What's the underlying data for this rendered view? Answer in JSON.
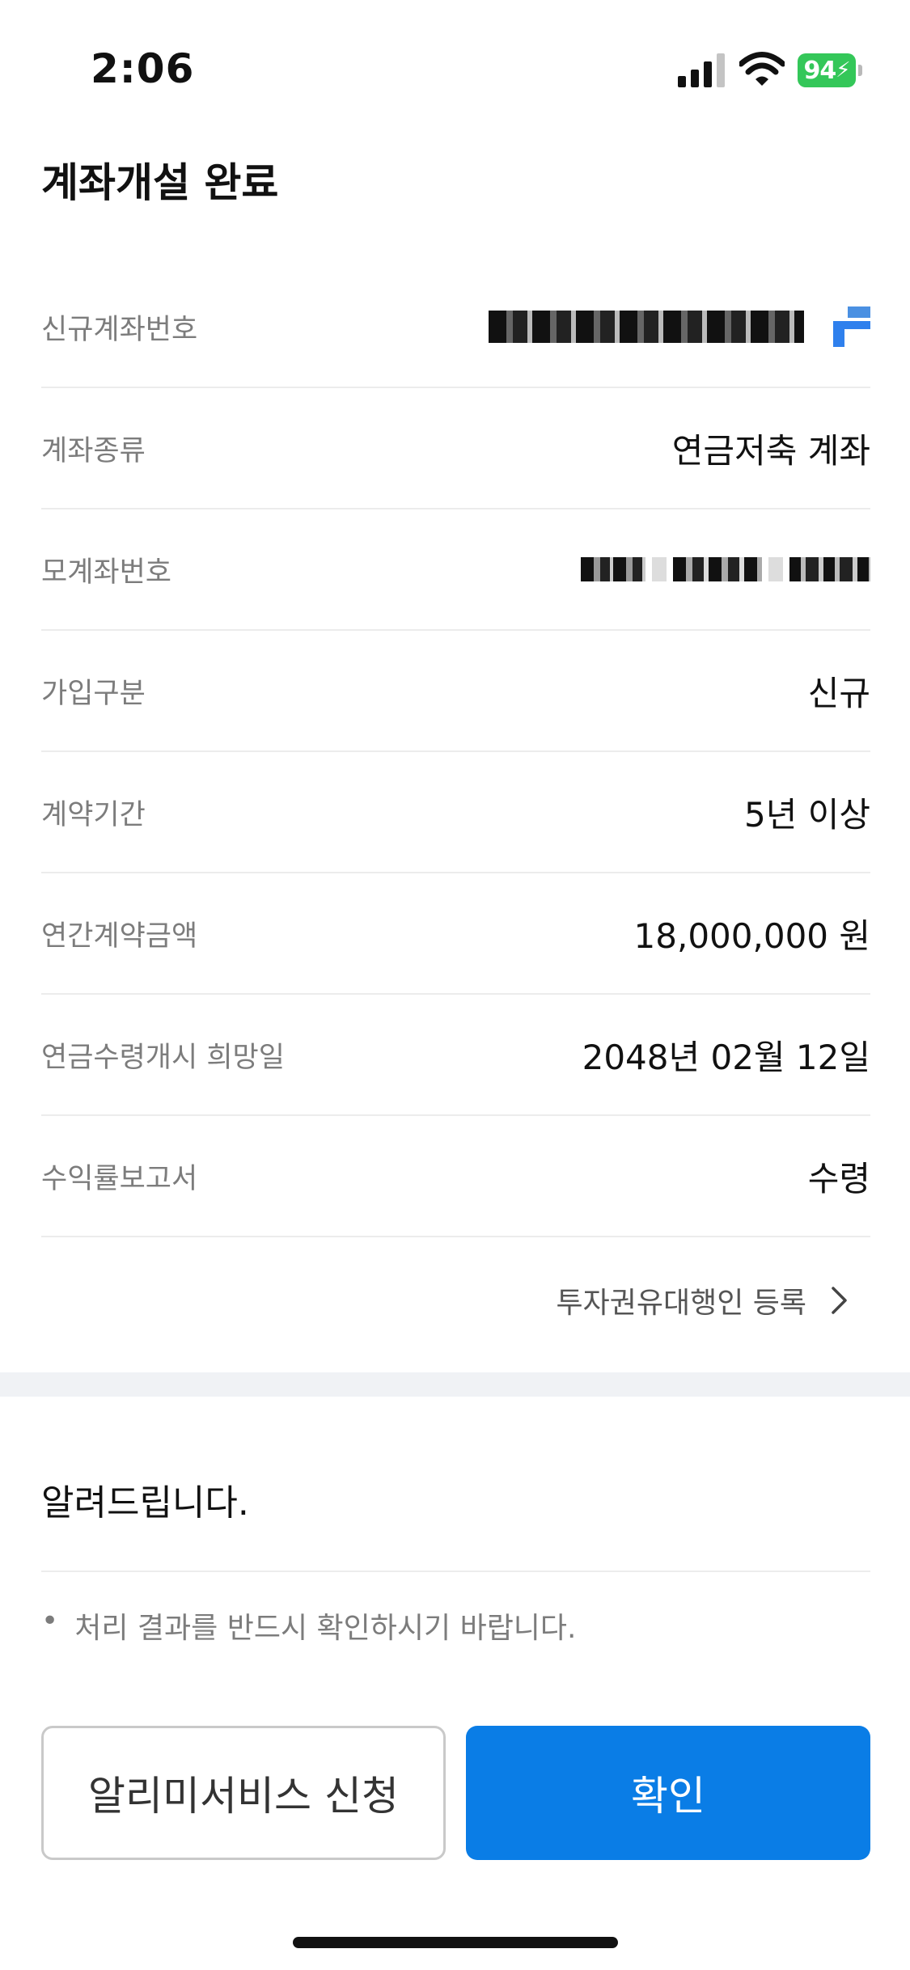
{
  "status_bar": {
    "time": "2:06",
    "battery_percent": "94",
    "battery_color": "#34c759",
    "signal_icon": "cellular-signal-icon",
    "wifi_icon": "wifi-icon",
    "battery_icon": "battery-charging-icon"
  },
  "header": {
    "title": "계좌개설 완료"
  },
  "rows": [
    {
      "label": "신규계좌번호",
      "value": ""
    },
    {
      "label": "계좌종류",
      "value": "연금저축 계좌"
    },
    {
      "label": "모계좌번호",
      "value": ""
    },
    {
      "label": "가입구분",
      "value": "신규"
    },
    {
      "label": "계약기간",
      "value": "5년 이상"
    },
    {
      "label": "연간계약금액",
      "value": "18,000,000 원"
    },
    {
      "label": "연금수령개시 희망일",
      "value": "2048년 02월 12일"
    },
    {
      "label": "수익률보고서",
      "value": "수령"
    }
  ],
  "agent_link": {
    "label": "투자권유대행인 등록",
    "icon": "chevron-right-icon"
  },
  "notice": {
    "title": "알려드립니다.",
    "items": [
      "처리 결과를 반드시 확인하시기 바랍니다."
    ]
  },
  "buttons": {
    "secondary": "알리미서비스 신청",
    "primary": "확인"
  },
  "colors": {
    "primary": "#0a7de6",
    "divider": "#f0f2f5"
  }
}
